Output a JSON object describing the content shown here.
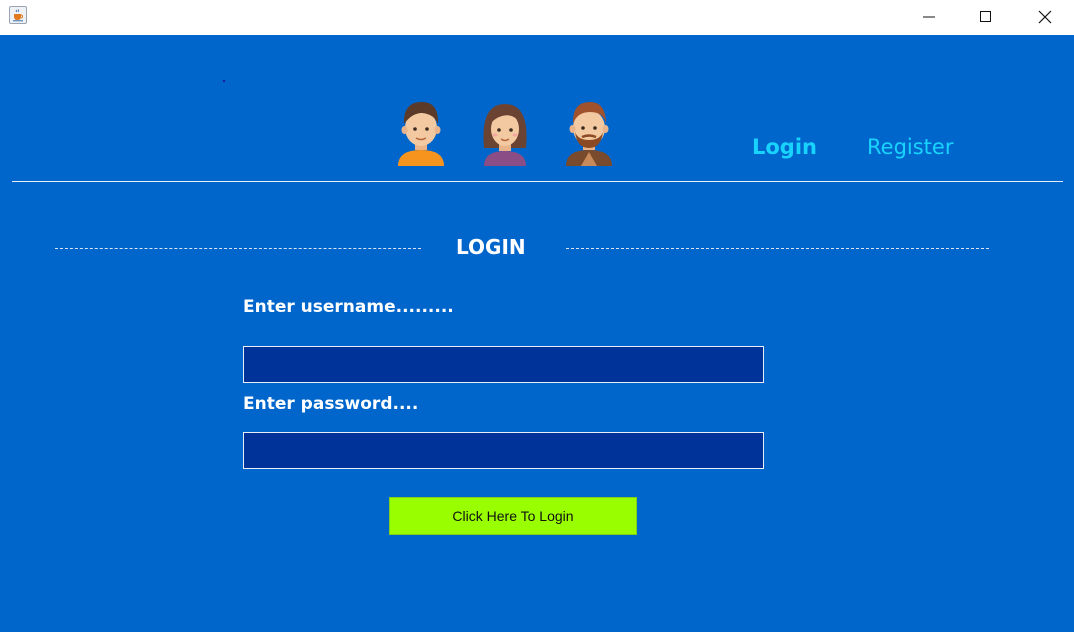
{
  "window": {
    "app_icon": "java-cup-icon",
    "controls": [
      "minimize-icon",
      "maximize-icon",
      "close-icon"
    ]
  },
  "header": {
    "avatars": [
      "boy-avatar-icon",
      "girl-avatar-icon",
      "bearded-man-avatar-icon"
    ],
    "nav": {
      "login_label": "Login",
      "register_label": "Register"
    }
  },
  "form": {
    "title": "LOGIN",
    "username_label": "Enter username.........",
    "username_value": "",
    "password_label": "Enter password....",
    "password_value": "",
    "submit_label": "Click Here To Login"
  },
  "colors": {
    "background": "#0066cc",
    "nav_text": "#19d3ff",
    "field_bg": "#003399",
    "button_bg": "#99ff00"
  }
}
